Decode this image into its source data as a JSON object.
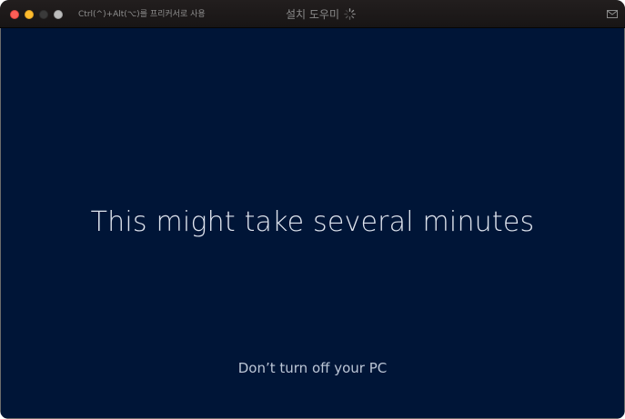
{
  "window": {
    "title": "설치 도우미",
    "hint": "Ctrl(^)+Alt(⌥)를 프리커서로 사용",
    "controls": {
      "close_color": "#fe5f57",
      "minimize_color": "#febc2e"
    },
    "icons": [
      "loading-spinner-icon",
      "mail-icon"
    ]
  },
  "screen": {
    "background": "#001537",
    "headline": "This might take several minutes",
    "subline": "Don’t turn off your PC"
  }
}
